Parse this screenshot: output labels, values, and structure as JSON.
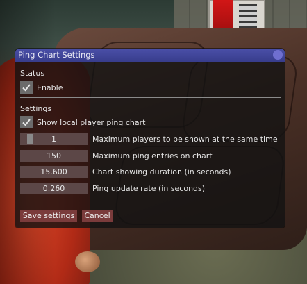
{
  "window": {
    "title": "Ping Chart Settings"
  },
  "status": {
    "heading": "Status",
    "enable": {
      "label": "Enable",
      "checked": true
    }
  },
  "settings": {
    "heading": "Settings",
    "show_local": {
      "label": "Show local player ping chart",
      "checked": true
    },
    "fields": [
      {
        "value": "1",
        "label": "Maximum players to be shown at the same time",
        "slider_fill": 0.1
      },
      {
        "value": "150",
        "label": "Maximum ping entries on chart"
      },
      {
        "value": "15.600",
        "label": "Chart showing duration (in seconds)"
      },
      {
        "value": "0.260",
        "label": "Ping update rate (in seconds)"
      }
    ]
  },
  "buttons": {
    "save": "Save settings",
    "cancel": "Cancel"
  },
  "colors": {
    "title_bar": "#3e43a0",
    "field_bg": "#5c4747",
    "button_bg": "#7a3b3b"
  }
}
